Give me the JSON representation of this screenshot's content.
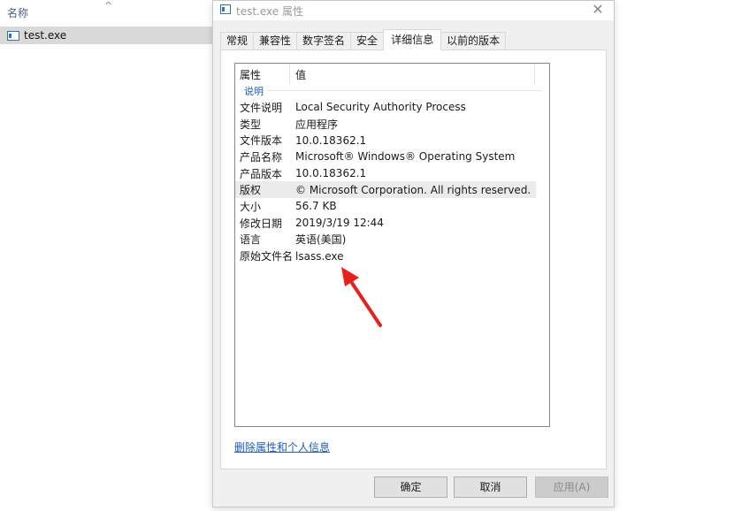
{
  "explorer": {
    "column_header": "名称",
    "file_name": "test.exe"
  },
  "dialog": {
    "title": "test.exe 属性",
    "close": "✕",
    "tabs": [
      "常规",
      "兼容性",
      "数字签名",
      "安全",
      "详细信息",
      "以前的版本"
    ],
    "active_tab": "详细信息",
    "list": {
      "header_property": "属性",
      "header_value": "值",
      "group": "说明",
      "rows": [
        {
          "prop": "文件说明",
          "val": "Local Security Authority Process"
        },
        {
          "prop": "类型",
          "val": "应用程序"
        },
        {
          "prop": "文件版本",
          "val": "10.0.18362.1"
        },
        {
          "prop": "产品名称",
          "val": "Microsoft® Windows® Operating System"
        },
        {
          "prop": "产品版本",
          "val": "10.0.18362.1"
        },
        {
          "prop": "版权",
          "val": "© Microsoft Corporation. All rights reserved."
        },
        {
          "prop": "大小",
          "val": "56.7 KB"
        },
        {
          "prop": "修改日期",
          "val": "2019/3/19 12:44"
        },
        {
          "prop": "语言",
          "val": "英语(美国)"
        },
        {
          "prop": "原始文件名",
          "val": "lsass.exe"
        }
      ]
    },
    "remove_link": "删除属性和个人信息",
    "buttons": {
      "ok": "确定",
      "cancel": "取消",
      "apply": "应用(A)"
    }
  },
  "colors": {
    "link": "#1e5bb8",
    "annotation_arrow": "#e8201c"
  }
}
